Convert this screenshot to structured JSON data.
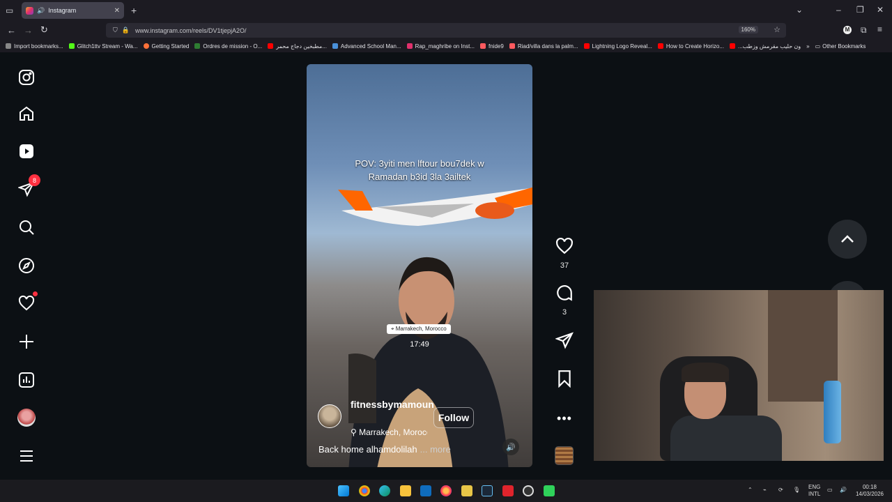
{
  "browser": {
    "tab_title": "Instagram",
    "url": "www.instagram.com/reels/DV1tjepjA2O/",
    "zoom": "160%",
    "profile_initial": "M",
    "bookmarks": [
      {
        "label": "Import bookmarks...",
        "color": "#aaaaaa"
      },
      {
        "label": "Glitch1ttv Stream - Wa...",
        "color": "#53fc18"
      },
      {
        "label": "Getting Started",
        "color": "#ff7139"
      },
      {
        "label": "Ordres de mission - O...",
        "color": "#2e7d32"
      },
      {
        "label": "مطبخين دجاج محمر...",
        "color": "#ff0000"
      },
      {
        "label": "Advanced School Man...",
        "color": "#4a90d9"
      },
      {
        "label": "Rap_maghribe on Inst...",
        "color": "#e1306c"
      },
      {
        "label": "fnide9",
        "color": "#ff5a5f"
      },
      {
        "label": "Riad/villa dans la palm...",
        "color": "#ff5a5f"
      },
      {
        "label": "Lightning Logo Reveal...",
        "color": "#ff0000"
      },
      {
        "label": "How to Create Horizo...",
        "color": "#ff0000"
      },
      {
        "label": "...ون حليب مقرمش وزطب",
        "color": "#ff0000"
      }
    ],
    "other_bookmarks": "Other Bookmarks"
  },
  "sidebar": {
    "messages_badge": "8"
  },
  "reel": {
    "overlay_line1": "POV: 3yiti men lftour bou7dek w",
    "overlay_line2": "Ramadan b3id 3la 3ailtek",
    "location_sticker": "Marrakech, Morocco",
    "time_overlay": "17:49",
    "username": "fitnessbymamoun",
    "location": "Marrakech, Morocco",
    "follow_label": "Follow",
    "caption": "Back home alhamdolilah",
    "caption_more": "... more",
    "likes": "37",
    "comments": "3"
  },
  "taskbar": {
    "lang_line1": "ENG",
    "lang_line2": "INTL",
    "time": "00:18",
    "date": "14/03/2026"
  }
}
